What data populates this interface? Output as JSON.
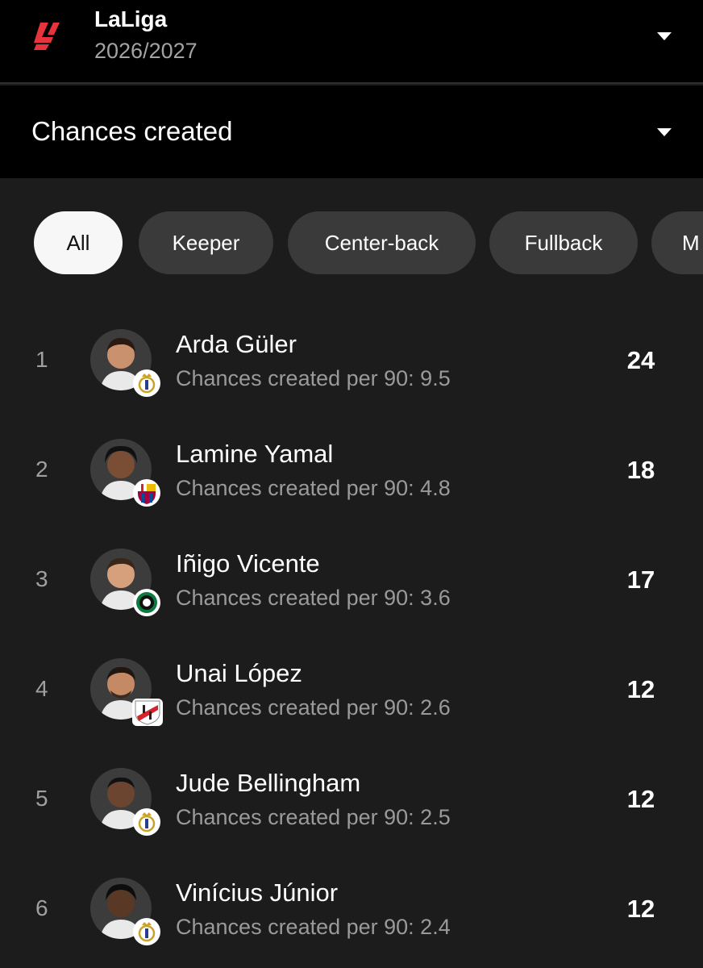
{
  "header": {
    "league_name": "LaLiga",
    "season": "2026/2027",
    "brand_color": "#e8333c"
  },
  "stat_selector": {
    "label": "Chances created"
  },
  "filters": {
    "chips": [
      "All",
      "Keeper",
      "Center-back",
      "Fullback",
      "M"
    ],
    "selected": "All"
  },
  "players": [
    {
      "rank": "1",
      "name": "Arda Güler",
      "subtitle": "Chances created per 90: 9.5",
      "value": "24",
      "club_badge": "real-madrid-badge-icon"
    },
    {
      "rank": "2",
      "name": "Lamine Yamal",
      "subtitle": "Chances created per 90: 4.8",
      "value": "18",
      "club_badge": "barcelona-badge-icon"
    },
    {
      "rank": "3",
      "name": "Iñigo Vicente",
      "subtitle": "Chances created per 90: 3.6",
      "value": "17",
      "club_badge": "racing-badge-icon"
    },
    {
      "rank": "4",
      "name": "Unai López",
      "subtitle": "Chances created per 90: 2.6",
      "value": "12",
      "club_badge": "rayo-badge-icon"
    },
    {
      "rank": "5",
      "name": "Jude Bellingham",
      "subtitle": "Chances created per 90: 2.5",
      "value": "12",
      "club_badge": "real-madrid-badge-icon"
    },
    {
      "rank": "6",
      "name": "Vinícius Júnior",
      "subtitle": "Chances created per 90: 2.4",
      "value": "12",
      "club_badge": "real-madrid-badge-icon"
    }
  ]
}
